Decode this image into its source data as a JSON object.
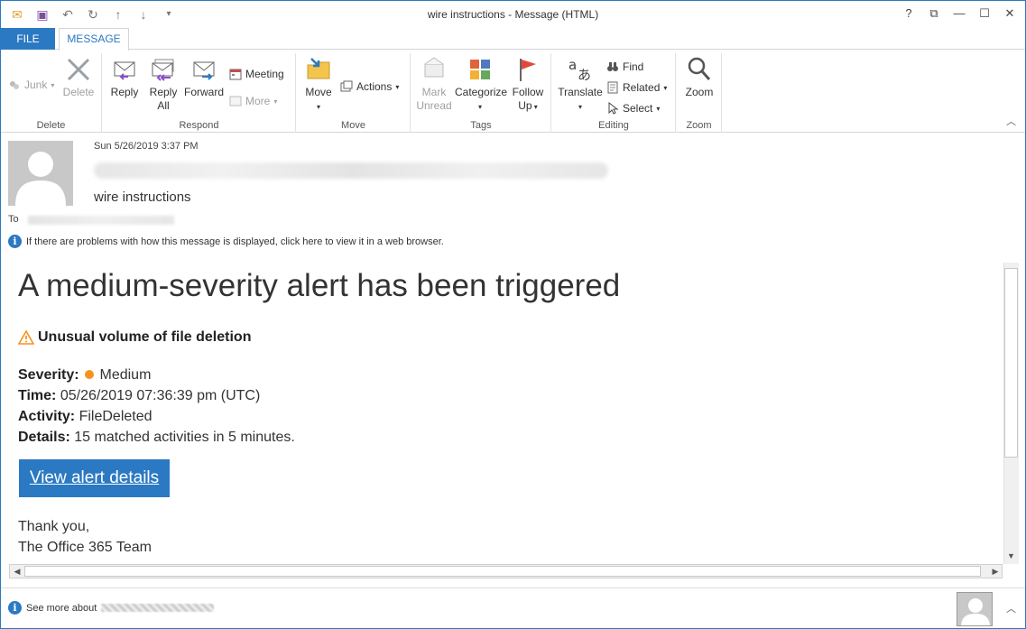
{
  "window": {
    "title": "wire instructions - Message (HTML)",
    "controls": [
      "?",
      "⧉",
      "—",
      "☐",
      "✕"
    ]
  },
  "qat": [
    "✉",
    "💾",
    "↶",
    "↻",
    "↑",
    "↓",
    "▾"
  ],
  "tabs": {
    "file": "FILE",
    "message": "MESSAGE"
  },
  "ribbon": {
    "delete": {
      "label": "Delete",
      "junk": "Junk",
      "delete": "Delete"
    },
    "respond": {
      "label": "Respond",
      "reply": "Reply",
      "reply_all_1": "Reply",
      "reply_all_2": "All",
      "forward": "Forward",
      "meeting": "Meeting",
      "more": "More"
    },
    "move": {
      "label": "Move",
      "move": "Move",
      "actions": "Actions"
    },
    "tags": {
      "label": "Tags",
      "mark_unread_1": "Mark",
      "mark_unread_2": "Unread",
      "categorize": "Categorize",
      "follow_up_1": "Follow",
      "follow_up_2": "Up"
    },
    "editing": {
      "label": "Editing",
      "translate": "Translate",
      "find": "Find",
      "related": "Related",
      "select": "Select"
    },
    "zoom": {
      "label": "Zoom",
      "zoom": "Zoom"
    }
  },
  "header": {
    "date": "Sun 5/26/2019 3:37 PM",
    "subject": "wire instructions",
    "to_label": "To",
    "info": "If there are problems with how this message is displayed, click here to view it in a web browser."
  },
  "body": {
    "title": "A medium-severity alert has been triggered",
    "alert_name": "Unusual volume of file deletion",
    "severity_label": "Severity:",
    "severity_value": "Medium",
    "time_label": "Time:",
    "time_value": "05/26/2019 07:36:39 pm (UTC)",
    "activity_label": "Activity:",
    "activity_value": "FileDeleted",
    "details_label": "Details:",
    "details_value": "15 matched activities in 5 minutes.",
    "cta": "View alert details",
    "sign1": "Thank you,",
    "sign2": "The Office 365 Team"
  },
  "footer": {
    "text": "See more about"
  },
  "colors": {
    "accent": "#2b79c2",
    "severity": "#f7931e",
    "warning": "#f7931e"
  }
}
